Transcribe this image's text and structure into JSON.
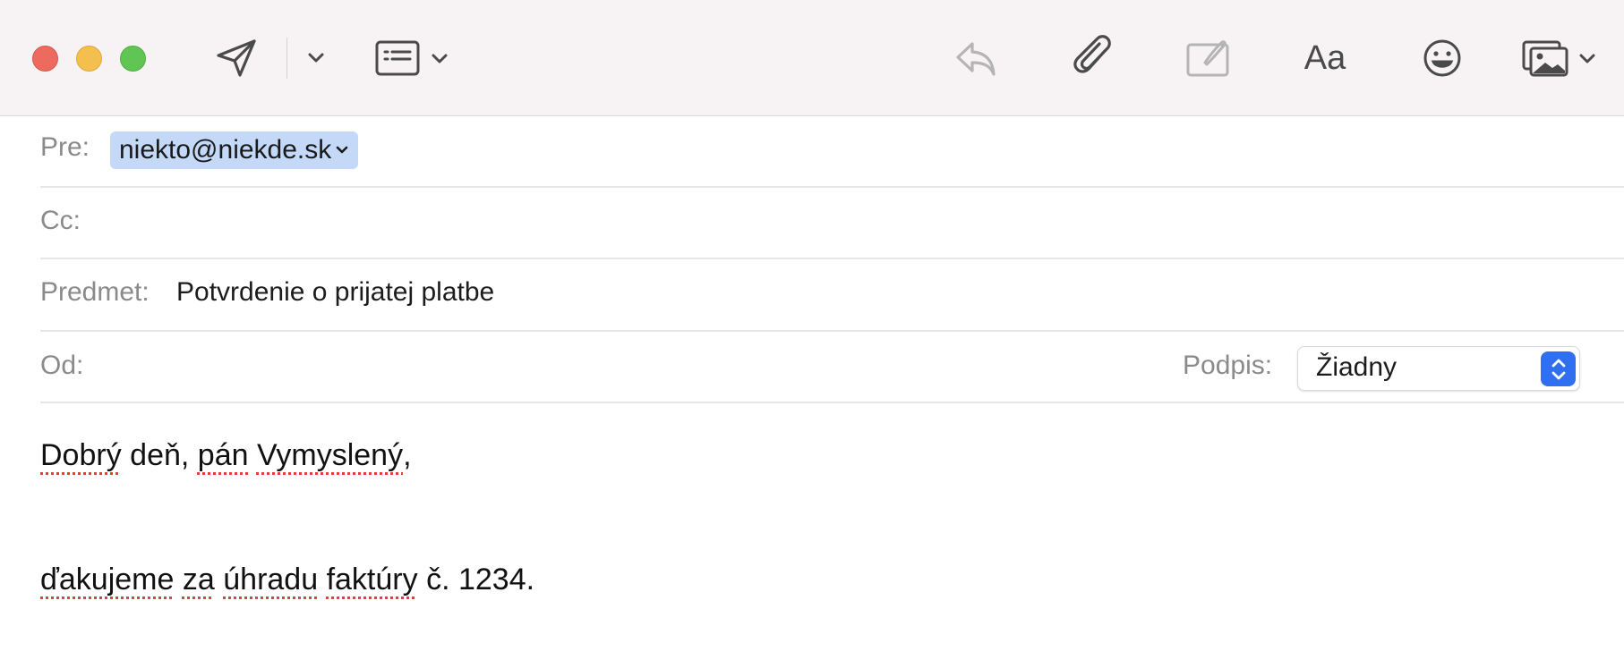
{
  "window": {
    "traffic_lights": [
      {
        "name": "close",
        "color": "#ed6a5e"
      },
      {
        "name": "minimize",
        "color": "#f5bf4f"
      },
      {
        "name": "zoom",
        "color": "#61c554"
      }
    ]
  },
  "toolbar": {
    "icons": [
      "send-icon",
      "send-options-chevron-icon",
      "header-fields-icon",
      "reply-icon",
      "attachment-icon",
      "markup-icon",
      "format-icon",
      "emoji-icon",
      "photo-browser-icon"
    ],
    "format_label": "Aa"
  },
  "header": {
    "to_label": "Pre:",
    "to_recipient": "niekto@niekde.sk",
    "cc_label": "Cc:",
    "subject_label": "Predmet:",
    "subject_value": "Potvrdenie o prijatej platbe",
    "from_label": "Od:",
    "signature_label": "Podpis:",
    "signature_value": "Žiadny"
  },
  "body": {
    "greeting_words": [
      "Dobrý",
      " ",
      "deň",
      ", ",
      "pán",
      " ",
      "Vymyslený",
      ","
    ],
    "line2_words": [
      "ďakujeme",
      " ",
      "za",
      " ",
      "úhradu",
      " ",
      "faktúry",
      " č. 1234."
    ]
  },
  "colors": {
    "accent": "#2f6ff0",
    "recipient_chip": "#c4d9f7",
    "spellcheck": "#e0403a",
    "toolbar_bg": "#f7f3f5"
  }
}
